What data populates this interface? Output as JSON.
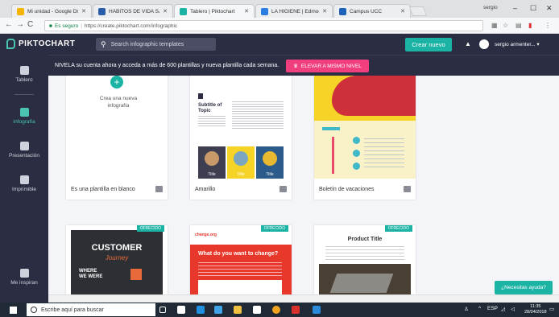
{
  "browser": {
    "tabs": [
      {
        "label": "Mi unidad - Google Drive",
        "color": "#f4b400"
      },
      {
        "label": "HÁBITOS DE VIDA SALUD",
        "color": "#2a5da8"
      },
      {
        "label": "Tablero | Piktochart",
        "color": "#1bb3a3"
      },
      {
        "label": "LA HIGIENE | Edmodo",
        "color": "#2a7de1"
      },
      {
        "label": "Campus UCC",
        "color": "#1e63b8"
      }
    ],
    "window_user": "sergio",
    "controls": {
      "minimize": "–",
      "maximize": "☐",
      "close": "✕"
    },
    "url_secure_label": "Es seguro",
    "url": "https://create.piktochart.com/infographic"
  },
  "header": {
    "logo": "PIKTOCHART",
    "search_placeholder": "Search infographic templates",
    "create_button": "Crear nuevo",
    "user_name": "sergio armenter... ▾"
  },
  "promo": {
    "message": "NIVELA su cuenta ahora y acceda a más de 600 plantillas y nueva plantilla cada semana.",
    "upgrade_button": "ELEVAR A MISMO NIVEL"
  },
  "sidebar": {
    "items": [
      {
        "label": "Tablero"
      },
      {
        "label": "Infografía"
      },
      {
        "label": "Presentación"
      },
      {
        "label": "Imprimible"
      },
      {
        "label": "Me inspiran"
      }
    ]
  },
  "templates": {
    "row1": [
      {
        "title": "Es una plantilla en blanco",
        "blank_text": "Crea una nueva infografía"
      },
      {
        "title": "Amarillo",
        "subtitle": "Subtitle of Topic",
        "cover_labels": [
          "Title",
          "Title",
          "Title"
        ]
      },
      {
        "title": "Boletín de vacaciones"
      }
    ],
    "row2": [
      {
        "badge": "OFRECIDO",
        "heading": "CUSTOMER",
        "subheading": "Journey",
        "text": "WHERE WE WERE"
      },
      {
        "badge": "OFRECIDO",
        "brand": "change.org",
        "heading": "What do you want to change?"
      },
      {
        "badge": "OFRECIDO",
        "heading": "Product Title"
      }
    ]
  },
  "help_button": "¿Necesitas ayuda?",
  "taskbar": {
    "search_placeholder": "Escribe aquí para buscar",
    "language": "ESP",
    "time": "11:35",
    "date": "28/04/2018"
  }
}
